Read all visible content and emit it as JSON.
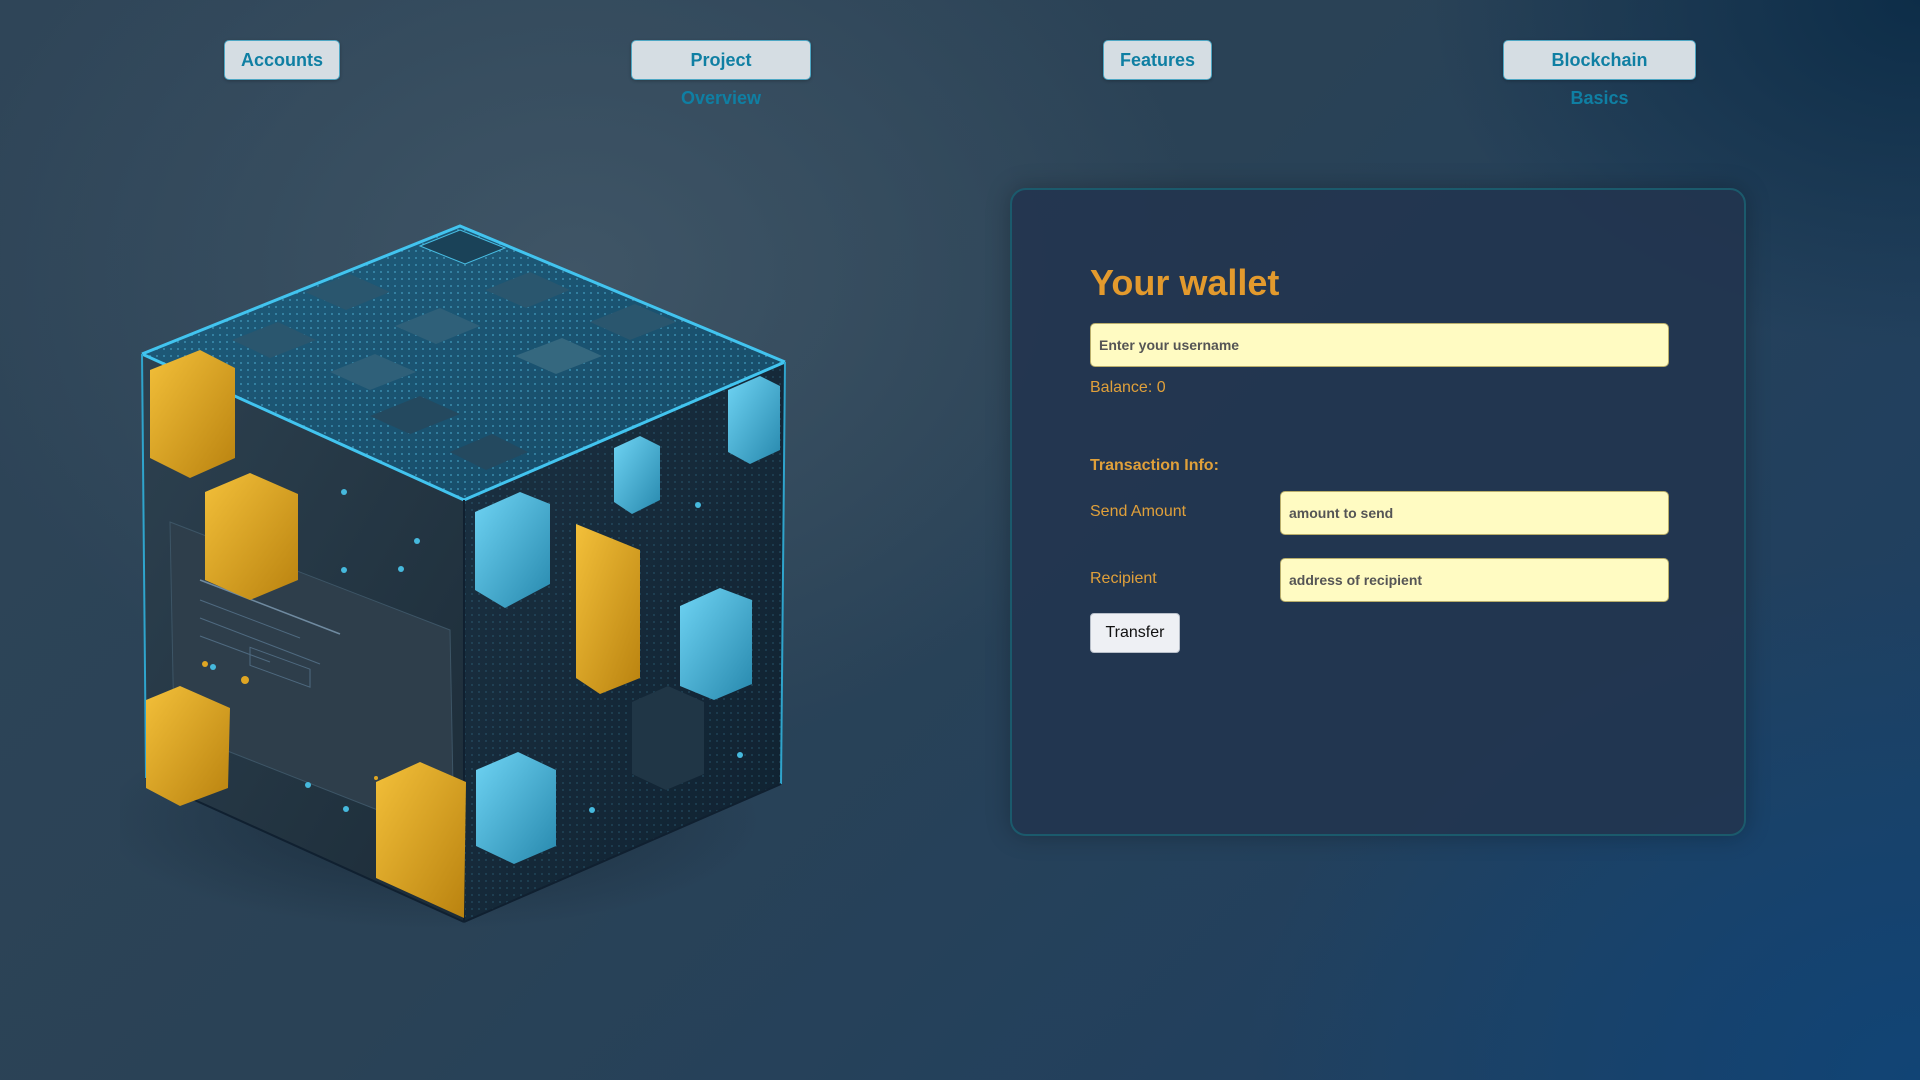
{
  "nav": {
    "accounts": "Accounts",
    "project_overview": "Project Overview",
    "features": "Features",
    "blockchain_basics": "Blockchain Basics"
  },
  "wallet": {
    "title": "Your wallet",
    "username_placeholder": "Enter your username",
    "balance_text": "Balance: 0",
    "transaction_info": "Transaction Info:",
    "send_amount_label": "Send Amount",
    "send_amount_placeholder": "amount to send",
    "recipient_label": "Recipient",
    "recipient_placeholder": "address of recipient",
    "transfer_button": "Transfer"
  },
  "colors": {
    "accent_orange": "#e39a2d",
    "nav_text": "#0f7fa3",
    "input_bg": "#fffbc2",
    "cube_blue": "#46b9dd",
    "cube_yellow": "#e0a623"
  },
  "illustration": "blockchain-cube-illustration"
}
